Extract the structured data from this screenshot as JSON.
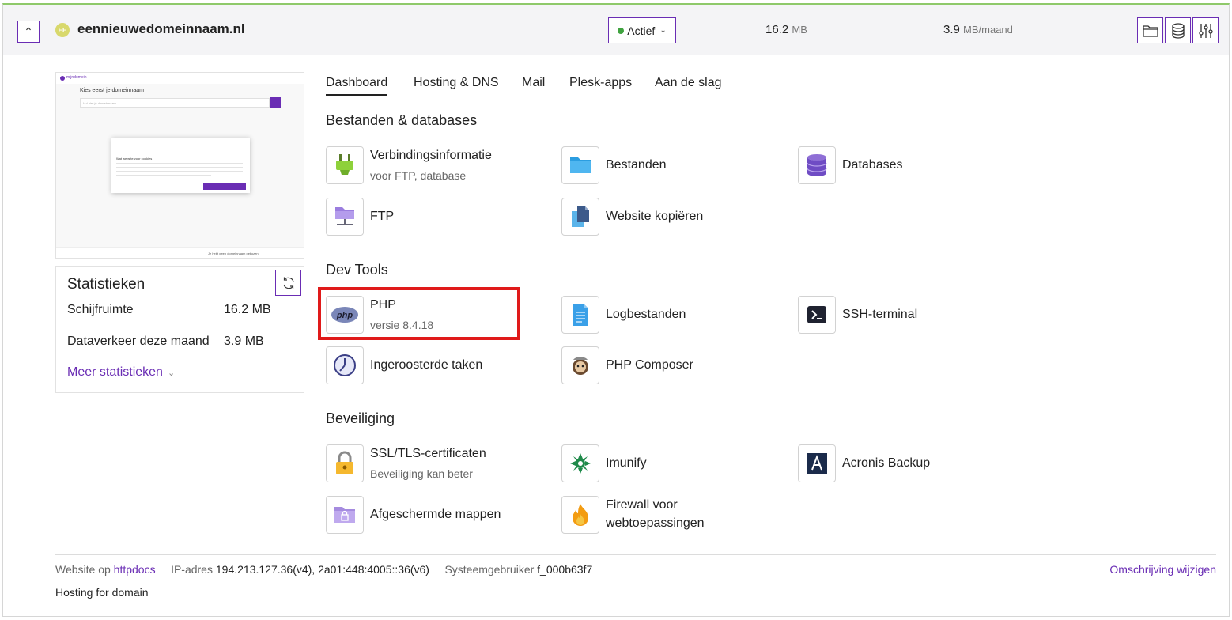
{
  "header": {
    "collapse_icon": "chevron-up-icon",
    "domain_badge": "EE",
    "domain": "eennieuwedomeinnaam.nl",
    "status": "Actief",
    "status_color": "#3fa33f",
    "disk_value": "16.2",
    "disk_unit": "MB",
    "traffic_value": "3.9",
    "traffic_unit": "MB/maand",
    "icons": [
      "folder-icon",
      "database-icon",
      "settings-sliders-icon"
    ]
  },
  "preview": {
    "logo_text": "mijndomein",
    "heading": "Kies eerst je domeinnaam",
    "input_placeholder": "Vul hier je domeinnaam",
    "modal_title": "Wat website voor cookies",
    "footer_text": "Je hebt geen domeinnaam gekozen"
  },
  "stats": {
    "title": "Statistieken",
    "rows": [
      {
        "label": "Schijfruimte",
        "value": "16.2 MB"
      },
      {
        "label": "Dataverkeer deze maand",
        "value": "3.9 MB"
      }
    ],
    "more": "Meer statistieken"
  },
  "tabs": [
    "Dashboard",
    "Hosting & DNS",
    "Mail",
    "Plesk-apps",
    "Aan de slag"
  ],
  "sections": {
    "files": "Bestanden & databases",
    "dev": "Dev Tools",
    "security": "Beveiliging"
  },
  "tools": {
    "conninfo": {
      "label": "Verbindingsinformatie",
      "sub": "voor FTP, database"
    },
    "bestanden": {
      "label": "Bestanden"
    },
    "databases": {
      "label": "Databases"
    },
    "ftp": {
      "label": "FTP"
    },
    "website_copy": {
      "label": "Website kopiëren"
    },
    "php": {
      "label": "PHP",
      "sub": "versie 8.4.18",
      "icon_text": "php"
    },
    "logs": {
      "label": "Logbestanden"
    },
    "ssh": {
      "label": "SSH-terminal"
    },
    "cron": {
      "label": "Ingeroosterde taken"
    },
    "composer": {
      "label": "PHP Composer"
    },
    "ssl": {
      "label": "SSL/TLS-certificaten",
      "sub": "Beveiliging kan beter"
    },
    "imunify": {
      "label": "Imunify"
    },
    "acronis": {
      "label": "Acronis Backup"
    },
    "protected": {
      "label": "Afgeschermde mappen"
    },
    "firewall": {
      "label": "Firewall voor",
      "label2": "webtoepassingen"
    }
  },
  "footer": {
    "website_on": "Website op",
    "docroot": "httpdocs",
    "ip_label": "IP-adres",
    "ip_value": "194.213.127.36(v4), 2a01:448:4005::36(v6)",
    "user_label": "Systeemgebruiker",
    "user_value": "f_000b63f7",
    "edit_link": "Omschrijving wijzigen",
    "description": "Hosting for domain"
  }
}
